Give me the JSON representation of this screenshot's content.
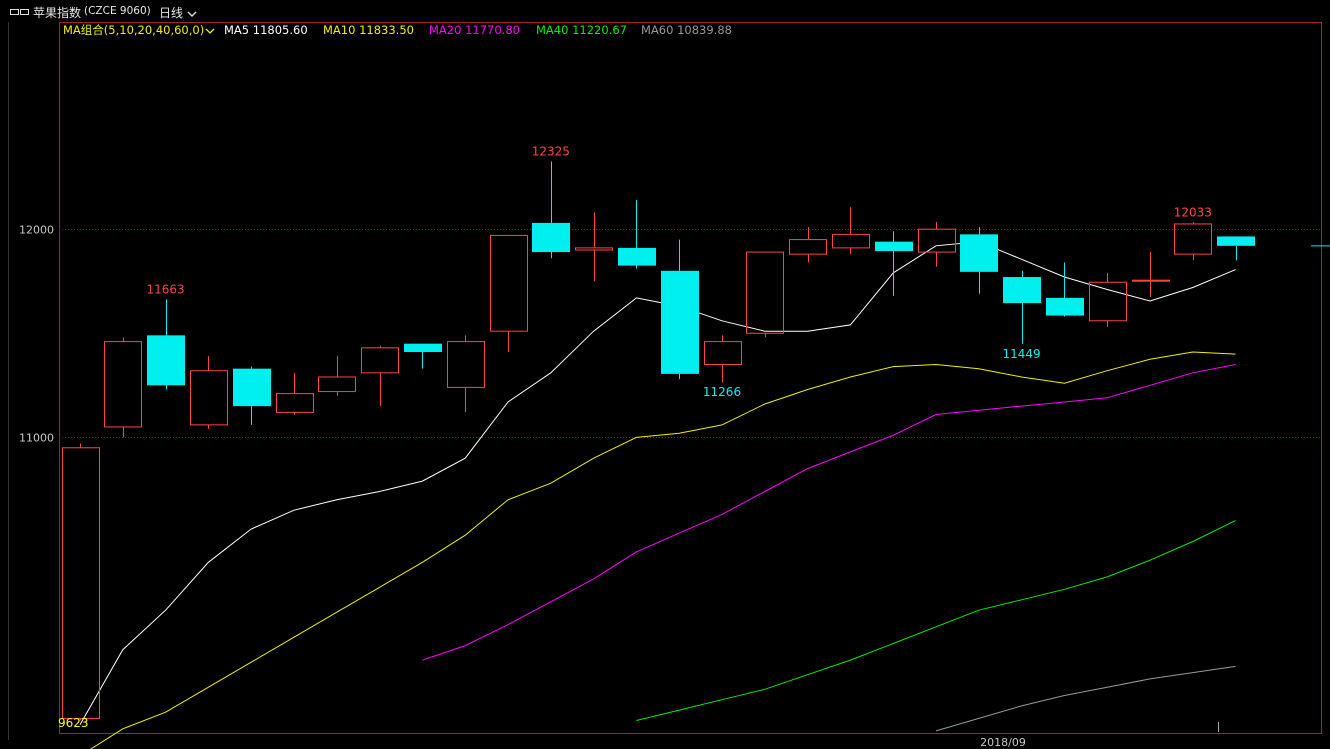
{
  "window": {
    "icon": "window-icon",
    "title": "苹果指数",
    "code": "(CZCE 9060)",
    "period": "日线"
  },
  "colors": {
    "background": "#000000",
    "frame": "#b02020",
    "grid": "#802020",
    "up": "#ff4444",
    "down": "#00f0f0",
    "ma5": "#ffffff",
    "ma10": "#f0f000",
    "ma20": "#ff00ff",
    "ma40": "#00ee00",
    "ma60": "#999999"
  },
  "legend": {
    "group_label": "MA组合(5,10,20,40,60,0)",
    "items": [
      {
        "key": "ma5",
        "text": "MA5 11805.60"
      },
      {
        "key": "ma10",
        "text": "MA10 11833.50"
      },
      {
        "key": "ma20",
        "text": "MA20 11770.80"
      },
      {
        "key": "ma40",
        "text": "MA40 11220.67"
      },
      {
        "key": "ma60",
        "text": "MA60 10839.88"
      }
    ]
  },
  "chart_data": {
    "type": "candlestick",
    "ylim": [
      9580,
      12995
    ],
    "yticks": [
      12000,
      11000
    ],
    "xlabel_month": "2018/09",
    "candles": [
      {
        "o": 9650,
        "h": 10970,
        "l": 9640,
        "c": 10950
      },
      {
        "o": 11050,
        "h": 11480,
        "l": 11000,
        "c": 11460
      },
      {
        "o": 11490,
        "h": 11663,
        "l": 11230,
        "c": 11250
      },
      {
        "o": 11060,
        "h": 11390,
        "l": 11040,
        "c": 11320
      },
      {
        "o": 11330,
        "h": 11340,
        "l": 11060,
        "c": 11150
      },
      {
        "o": 11120,
        "h": 11310,
        "l": 11110,
        "c": 11210
      },
      {
        "o": 11220,
        "h": 11390,
        "l": 11200,
        "c": 11290
      },
      {
        "o": 11310,
        "h": 11440,
        "l": 11150,
        "c": 11430
      },
      {
        "o": 11450,
        "h": 11450,
        "l": 11330,
        "c": 11410
      },
      {
        "o": 11240,
        "h": 11490,
        "l": 11120,
        "c": 11460
      },
      {
        "o": 11510,
        "h": 11490,
        "l": 11410,
        "c": 11970
      },
      {
        "o": 12030,
        "h": 12325,
        "l": 11860,
        "c": 11890
      },
      {
        "o": 11900,
        "h": 12080,
        "l": 11750,
        "c": 11910
      },
      {
        "o": 11910,
        "h": 12140,
        "l": 11810,
        "c": 11825
      },
      {
        "o": 11800,
        "h": 11950,
        "l": 11280,
        "c": 11305
      },
      {
        "o": 11350,
        "h": 11490,
        "l": 11266,
        "c": 11460
      },
      {
        "o": 11500,
        "h": 11890,
        "l": 11480,
        "c": 11890
      },
      {
        "o": 11880,
        "h": 12010,
        "l": 11840,
        "c": 11950
      },
      {
        "o": 11910,
        "h": 12105,
        "l": 11880,
        "c": 11975
      },
      {
        "o": 11940,
        "h": 11990,
        "l": 11680,
        "c": 11895
      },
      {
        "o": 11890,
        "h": 12035,
        "l": 11820,
        "c": 12000
      },
      {
        "o": 11975,
        "h": 12010,
        "l": 11690,
        "c": 11795
      },
      {
        "o": 11770,
        "h": 11800,
        "l": 11449,
        "c": 11645
      },
      {
        "o": 11670,
        "h": 11840,
        "l": 11580,
        "c": 11585
      },
      {
        "o": 11560,
        "h": 11790,
        "l": 11530,
        "c": 11745
      },
      {
        "o": 11755,
        "h": 11890,
        "l": 11675,
        "c": 11755
      },
      {
        "o": 11880,
        "h": 12033,
        "l": 11850,
        "c": 12025
      },
      {
        "o": 11965,
        "h": 11965,
        "l": 11850,
        "c": 11920
      }
    ],
    "last_price": 11920,
    "ma": {
      "ma5": [
        9620,
        9980,
        10170,
        10400,
        10560,
        10650,
        10700,
        10740,
        10790,
        10900,
        11170,
        11310,
        11510,
        11670,
        11630,
        11560,
        11510,
        11510,
        11540,
        11790,
        11920,
        11940,
        11855,
        11770,
        11710,
        11655,
        11720,
        11805.6
      ],
      "ma10": [
        9470,
        9600,
        9680,
        9800,
        9920,
        10040,
        10160,
        10280,
        10400,
        10530,
        10700,
        10780,
        10900,
        11000,
        11020,
        11060,
        11160,
        11230,
        11290,
        11340,
        11350,
        11330,
        11290,
        11260,
        11320,
        11375,
        11410,
        11400
      ],
      "ma20": [
        null,
        null,
        null,
        null,
        null,
        null,
        null,
        null,
        9930,
        10000,
        10100,
        10210,
        10320,
        10450,
        10540,
        10630,
        10740,
        10850,
        10930,
        11010,
        11110,
        11130,
        11150,
        11170,
        11190,
        11250,
        11310,
        11350
      ],
      "ma40": [
        null,
        null,
        null,
        null,
        null,
        null,
        null,
        null,
        null,
        null,
        null,
        null,
        null,
        9640,
        9690,
        9740,
        9790,
        9860,
        9930,
        10010,
        10090,
        10170,
        10220,
        10270,
        10330,
        10410,
        10500,
        10600
      ],
      "ma60": [
        null,
        null,
        null,
        null,
        null,
        null,
        null,
        null,
        null,
        null,
        null,
        null,
        null,
        null,
        null,
        null,
        null,
        null,
        null,
        null,
        9590,
        9650,
        9710,
        9760,
        9800,
        9840,
        9870,
        9900
      ]
    },
    "annotations": [
      {
        "i": 2,
        "text": "11663",
        "kind": "high",
        "color": "#ff4444"
      },
      {
        "i": 11,
        "text": "12325",
        "kind": "high",
        "color": "#ff4444"
      },
      {
        "i": 15,
        "text": "11266",
        "kind": "low",
        "color": "#00f0f0"
      },
      {
        "i": 22,
        "text": "11449",
        "kind": "low",
        "color": "#00f0f0"
      },
      {
        "i": 26,
        "text": "12033",
        "kind": "high",
        "color": "#ff4444"
      },
      {
        "i": 0,
        "text": "9623",
        "kind": "low",
        "color": "#ffff00"
      }
    ]
  }
}
